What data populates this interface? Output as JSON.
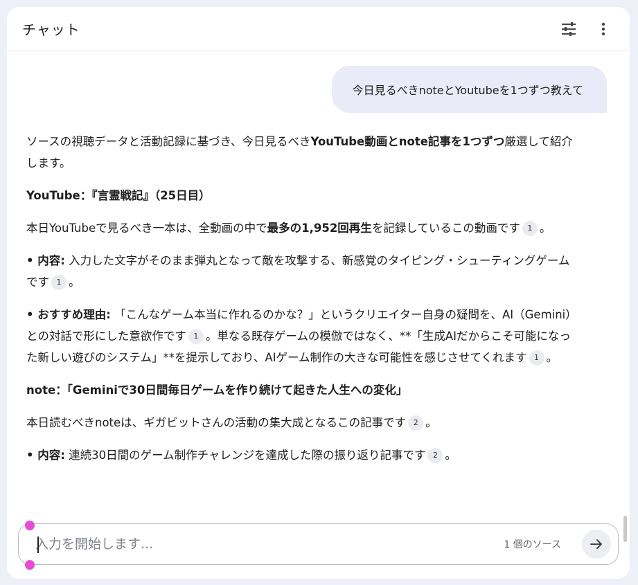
{
  "header": {
    "title": "チャット"
  },
  "user_message": "今日見るべきnoteとYoutubeを1つずつ教えて",
  "answer": {
    "intro_1": "ソースの視聴データと活動記録に基づき、今日見るべき",
    "intro_bold": "YouTube動画とnote記事を1つずつ",
    "intro_2": "厳選して紹介します。",
    "yt_heading": "YouTube：『言霊戦記』（25日目）",
    "yt_p1_a": "本日YouTubeで見るべき一本は、全動画の中で",
    "yt_p1_bold": "最多の1,952回再生",
    "yt_p1_b": "を記録しているこの動画です",
    "yt_p1_end": "。",
    "yt_content_label": "• 内容:",
    "yt_content_text": " 入力した文字がそのまま弾丸となって敵を攻撃する、新感覚のタイピング・シューティングゲームです",
    "yt_content_end": "。",
    "yt_reason_label": "• おすすめ理由:",
    "yt_reason_a": " 「こんなゲーム本当に作れるのかな？」というクリエイター自身の疑問を、AI（Gemini）との対話で形にした意欲作です",
    "yt_reason_b": "。単なる既存ゲームの模倣ではなく、**「生成AIだからこそ可能になった新しい遊びのシステム」**を提示しており、AIゲーム制作の大きな可能性を感じさせてくれます",
    "yt_reason_end": "。",
    "note_heading": "note：「Geminiで30日間毎日ゲームを作り続けて起きた人生への変化」",
    "note_p1": "本日読むべきnoteは、ギガビットさんの活動の集大成となるこの記事です",
    "note_p1_end": "。",
    "note_content_label": "• 内容:",
    "note_content_text": " 連続30日間のゲーム制作チャレンジを達成した際の振り返り記事です",
    "note_content_end": "。",
    "cite_1": "1",
    "cite_2": "2"
  },
  "input": {
    "placeholder": "入力を開始します...",
    "source_count": "1 個のソース"
  }
}
